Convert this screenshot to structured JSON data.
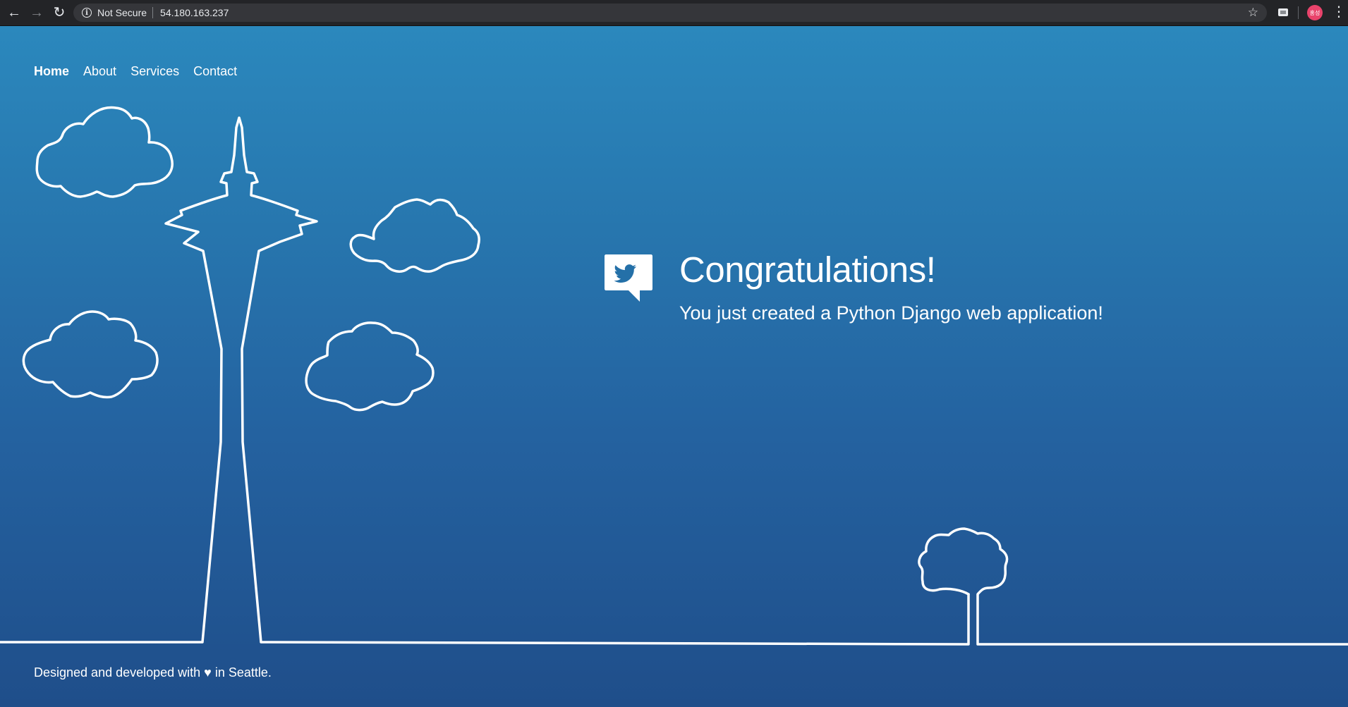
{
  "browser": {
    "back_icon": "arrow-left-icon",
    "forward_icon": "arrow-right-icon",
    "reload_icon": "reload-icon",
    "security_label": "Not Secure",
    "url": "54.180.163.237",
    "avatar_text": "홍성"
  },
  "nav": {
    "items": [
      {
        "label": "Home"
      },
      {
        "label": "About"
      },
      {
        "label": "Services"
      },
      {
        "label": "Contact"
      }
    ]
  },
  "hero": {
    "title": "Congratulations!",
    "subtitle": "You just created a Python Django web application!",
    "icon": "twitter-speech-bubble-icon"
  },
  "footer": {
    "text": "Designed and developed with ♥ in Seattle."
  },
  "colors": {
    "gradient_top": "#2b88bd",
    "gradient_bottom": "#1f4e8a",
    "line": "#ffffff"
  }
}
